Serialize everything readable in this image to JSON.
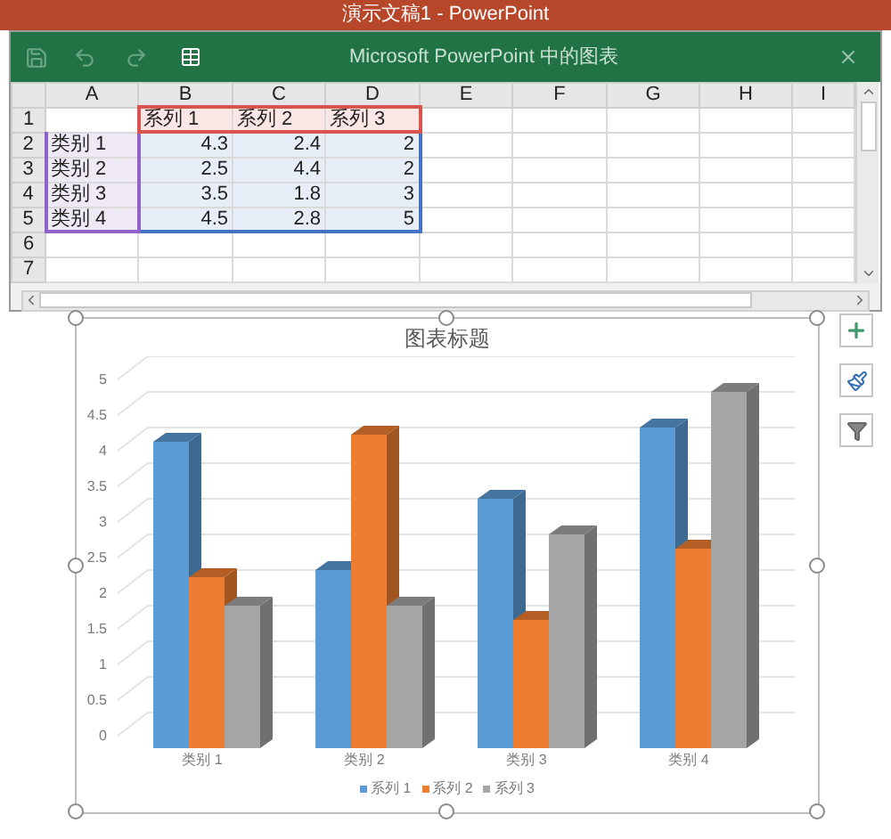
{
  "app_title": "演示文稿1 - PowerPoint",
  "sheet_window": {
    "title": "Microsoft PowerPoint 中的图表",
    "columns": [
      "A",
      "B",
      "C",
      "D",
      "E",
      "F",
      "G",
      "H",
      "I"
    ],
    "rows": [
      {
        "number": "1",
        "kind": "header",
        "values": [
          "系列 1",
          "系列 2",
          "系列 3"
        ]
      },
      {
        "number": "2",
        "kind": "data",
        "label": "类别 1",
        "values": [
          "4.3",
          "2.4",
          "2"
        ]
      },
      {
        "number": "3",
        "kind": "data",
        "label": "类别 2",
        "values": [
          "2.5",
          "4.4",
          "2"
        ]
      },
      {
        "number": "4",
        "kind": "data",
        "label": "类别 3",
        "values": [
          "3.5",
          "1.8",
          "3"
        ]
      },
      {
        "number": "5",
        "kind": "data",
        "label": "类别 4",
        "values": [
          "4.5",
          "2.8",
          "5"
        ]
      },
      {
        "number": "6",
        "kind": "empty"
      },
      {
        "number": "7",
        "kind": "empty"
      }
    ]
  },
  "chart": {
    "title": "图表标题",
    "chart_data": {
      "type": "bar",
      "categories": [
        "类别 1",
        "类别 2",
        "类别 3",
        "类别 4"
      ],
      "series": [
        {
          "name": "系列 1",
          "color": "#5b9bd5",
          "values": [
            4.3,
            2.5,
            3.5,
            4.5
          ]
        },
        {
          "name": "系列 2",
          "color": "#ed7d31",
          "values": [
            2.4,
            4.4,
            1.8,
            2.8
          ]
        },
        {
          "name": "系列 3",
          "color": "#a5a5a5",
          "values": [
            2,
            2,
            3,
            5
          ]
        }
      ],
      "ylim": [
        0,
        5
      ],
      "yticks": [
        0,
        0.5,
        1,
        1.5,
        2,
        2.5,
        3,
        3.5,
        4,
        4.5,
        5
      ]
    }
  }
}
